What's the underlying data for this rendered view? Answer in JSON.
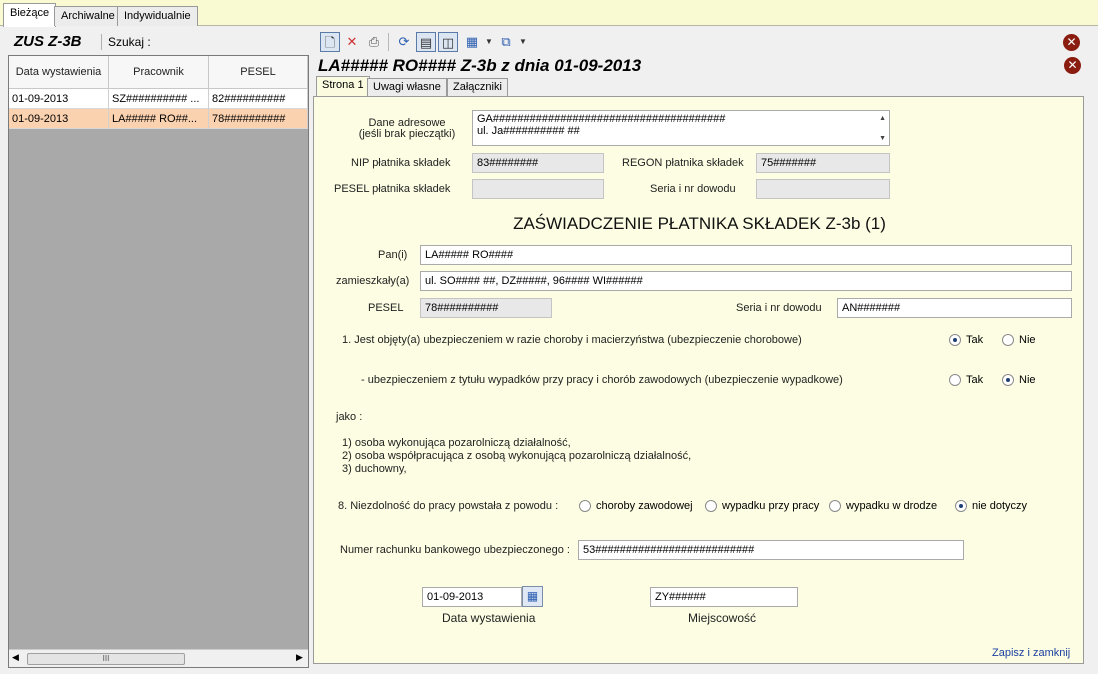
{
  "top_tabs": [
    "Bieżące",
    "Archiwalne",
    "Indywidualnie"
  ],
  "left": {
    "title": "ZUS Z-3B",
    "search_label": "Szukaj :",
    "columns": [
      "Data wystawienia",
      "Pracownik",
      "PESEL"
    ],
    "rows": [
      {
        "date": "01-09-2013",
        "employee": "SZ########## ...",
        "pesel": "82##########"
      },
      {
        "date": "01-09-2013",
        "employee": "LA##### RO##...",
        "pesel": "78##########"
      }
    ],
    "scroll_thumb": "III"
  },
  "toolbar": {
    "icons": [
      "new-document-icon",
      "delete-icon",
      "print-icon",
      "refresh-icon",
      "report-icon",
      "split-view-icon",
      "grid-icon",
      "copy-icon"
    ]
  },
  "doc_title": "LA##### RO#### Z-3b z dnia 01-09-2013",
  "inner_tabs": [
    "Strona 1",
    "Uwagi własne",
    "Załączniki"
  ],
  "form": {
    "address_label_1": "Dane adresowe",
    "address_label_2": "(jeśli brak pieczątki)",
    "address_line_1": "GA######################################",
    "address_line_2": "ul. Ja########## ##",
    "nip_label": "NIP płatnika składek",
    "nip_value": "83########",
    "regon_label": "REGON płatnika składek",
    "regon_value": "75#######",
    "pesel_payer_label": "PESEL płatnika składek",
    "pesel_payer_value": "",
    "id_payer_label": "Seria i nr dowodu",
    "id_payer_value": "",
    "heading": "ZAŚWIADCZENIE PŁATNIKA SKŁADEK Z-3b (1)",
    "pan_label": "Pan(i)",
    "pan_value": "LA##### RO####",
    "address_person_label": "zamieszkały(a)",
    "address_person_value": "ul. SO#### ##, DZ#####, 96#### WI######",
    "pesel_label": "PESEL",
    "pesel_value": "78##########",
    "id_label": "Seria i nr dowodu",
    "id_value": "AN#######",
    "q1": "1. Jest objęty(a) ubezpieczeniem w razie choroby i macierzyństwa (ubezpieczenie chorobowe)",
    "q1b": "- ubezpieczeniem z tytułu wypadków przy pracy i chorób zawodowych (ubezpieczenie wypadkowe)",
    "yes": "Tak",
    "no": "Nie",
    "jako": "jako :",
    "list_1": "1) osoba wykonująca pozarolniczą działalność,",
    "list_2": "2) osoba współpracująca z osobą wykonującą pozarolniczą działalność,",
    "list_3": "3) duchowny,",
    "q8": "8. Niezdolność do pracy powstała z powodu :",
    "q8_options": [
      "choroby zawodowej",
      "wypadku przy pracy",
      "wypadku w drodze",
      "nie dotyczy"
    ],
    "account_label": "Numer rachunku bankowego ubezpieczonego :",
    "account_value": "53##########################",
    "date_value": "01-09-2013",
    "date_label": "Data wystawienia",
    "place_value": "ZY######",
    "place_label": "Miejscowość",
    "save_link": "Zapisz i zamknij"
  }
}
